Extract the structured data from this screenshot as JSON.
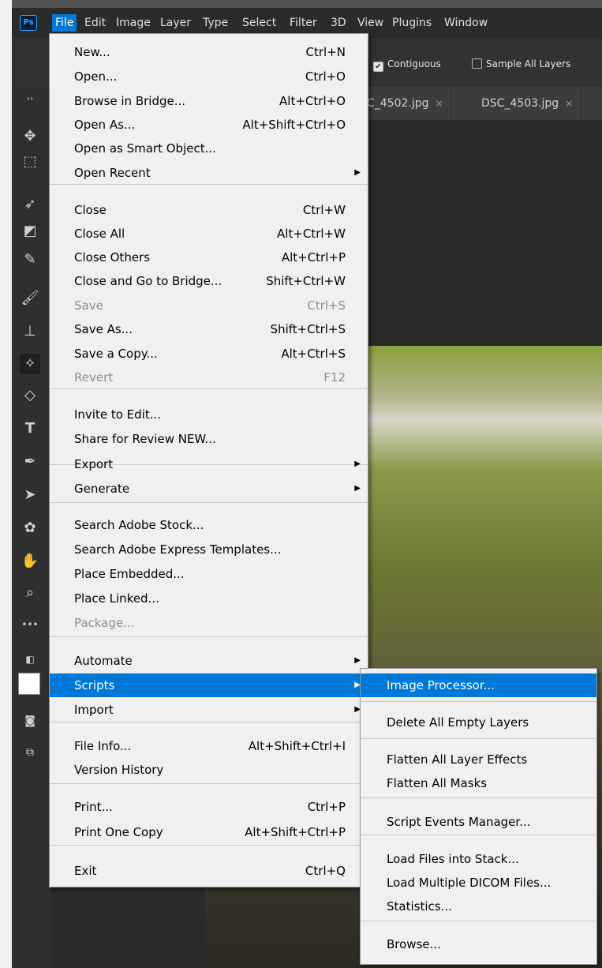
{
  "app": {
    "logo": "Ps",
    "menus": [
      "File",
      "Edit",
      "Image",
      "Layer",
      "Type",
      "Select",
      "Filter",
      "3D",
      "View",
      "Plugins",
      "Window"
    ],
    "active_menu": "File"
  },
  "options_bar": {
    "contiguous_label": "Contiguous",
    "contiguous_checked": true,
    "sample_all_layers_label": "Sample All Layers",
    "sample_all_layers_checked": false
  },
  "tabs": [
    {
      "label": "C_4502.jpg",
      "close": "×"
    },
    {
      "label": "DSC_4503.jpg",
      "close": "×"
    }
  ],
  "toolbar": {
    "collapse": "››",
    "icons": [
      "move-icon",
      "marquee-icon",
      "lasso-icon",
      "object-select-icon",
      "eyedropper-icon",
      "brush-icon",
      "stamp-icon",
      "magic-eraser-icon",
      "paint-bucket-icon",
      "type-icon",
      "pen-icon",
      "path-select-icon",
      "shape-icon",
      "hand-icon",
      "zoom-icon",
      "more-icon"
    ],
    "more_glyph": "•••"
  },
  "file_menu": {
    "items": [
      {
        "label": "New...",
        "shortcut": "Ctrl+N"
      },
      {
        "label": "Open...",
        "shortcut": "Ctrl+O"
      },
      {
        "label": "Browse in Bridge...",
        "shortcut": "Alt+Ctrl+O"
      },
      {
        "label": "Open As...",
        "shortcut": "Alt+Shift+Ctrl+O"
      },
      {
        "label": "Open as Smart Object...",
        "shortcut": ""
      },
      {
        "label": "Open Recent",
        "shortcut": "",
        "submenu": true
      },
      {
        "label": "Close",
        "shortcut": "Ctrl+W"
      },
      {
        "label": "Close All",
        "shortcut": "Alt+Ctrl+W"
      },
      {
        "label": "Close Others",
        "shortcut": "Alt+Ctrl+P"
      },
      {
        "label": "Close and Go to Bridge...",
        "shortcut": "Shift+Ctrl+W"
      },
      {
        "label": "Save",
        "shortcut": "Ctrl+S",
        "disabled": true
      },
      {
        "label": "Save As...",
        "shortcut": "Shift+Ctrl+S"
      },
      {
        "label": "Save a Copy...",
        "shortcut": "Alt+Ctrl+S"
      },
      {
        "label": "Revert",
        "shortcut": "F12",
        "disabled": true
      },
      {
        "label": "Invite to Edit...",
        "shortcut": ""
      },
      {
        "label": "Share for Review NEW...",
        "shortcut": ""
      },
      {
        "label": "Export",
        "shortcut": "",
        "submenu": true
      },
      {
        "label": "Generate",
        "shortcut": "",
        "submenu": true
      },
      {
        "label": "Search Adobe Stock...",
        "shortcut": ""
      },
      {
        "label": "Search Adobe Express Templates...",
        "shortcut": ""
      },
      {
        "label": "Place Embedded...",
        "shortcut": ""
      },
      {
        "label": "Place Linked...",
        "shortcut": ""
      },
      {
        "label": "Package...",
        "shortcut": "",
        "disabled": true
      },
      {
        "label": "Automate",
        "shortcut": "",
        "submenu": true
      },
      {
        "label": "Scripts",
        "shortcut": "",
        "submenu": true,
        "highlighted": true
      },
      {
        "label": "Import",
        "shortcut": "",
        "submenu": true
      },
      {
        "label": "File Info...",
        "shortcut": "Alt+Shift+Ctrl+I"
      },
      {
        "label": "Version History",
        "shortcut": ""
      },
      {
        "label": "Print...",
        "shortcut": "Ctrl+P"
      },
      {
        "label": "Print One Copy",
        "shortcut": "Alt+Shift+Ctrl+P"
      },
      {
        "label": "Exit",
        "shortcut": "Ctrl+Q"
      }
    ]
  },
  "scripts_menu": {
    "items": [
      {
        "label": "Image Processor...",
        "highlighted": true
      },
      {
        "label": "Delete All Empty Layers"
      },
      {
        "label": "Flatten All Layer Effects"
      },
      {
        "label": "Flatten All Masks"
      },
      {
        "label": "Script Events Manager..."
      },
      {
        "label": "Load Files into Stack..."
      },
      {
        "label": "Load Multiple DICOM Files..."
      },
      {
        "label": "Statistics..."
      },
      {
        "label": "Browse..."
      }
    ]
  },
  "colors": {
    "highlight": "#0078d7",
    "menu_bg": "#f0f0f0",
    "chrome_dark": "#2b2b2b"
  }
}
